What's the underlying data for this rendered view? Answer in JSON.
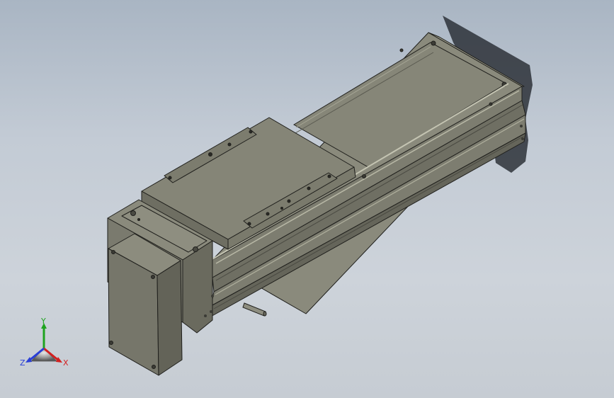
{
  "viewport": {
    "background_top": "#a9b5c3",
    "background_bottom": "#c6ccd3",
    "model": "linear-actuator-module"
  },
  "colors": {
    "face_top": "#8d8d7f",
    "face_front": "#7a7a6d",
    "face_side": "#6a6a5e",
    "edge": "#1f1f1c",
    "highlight": "#b8b8a6",
    "shadow": "#2d3138"
  },
  "triad": {
    "x_label": "X",
    "y_label": "Y",
    "z_label": "Z",
    "x_color": "#d32020",
    "y_color": "#1fa31f",
    "z_color": "#2a3fd6"
  }
}
